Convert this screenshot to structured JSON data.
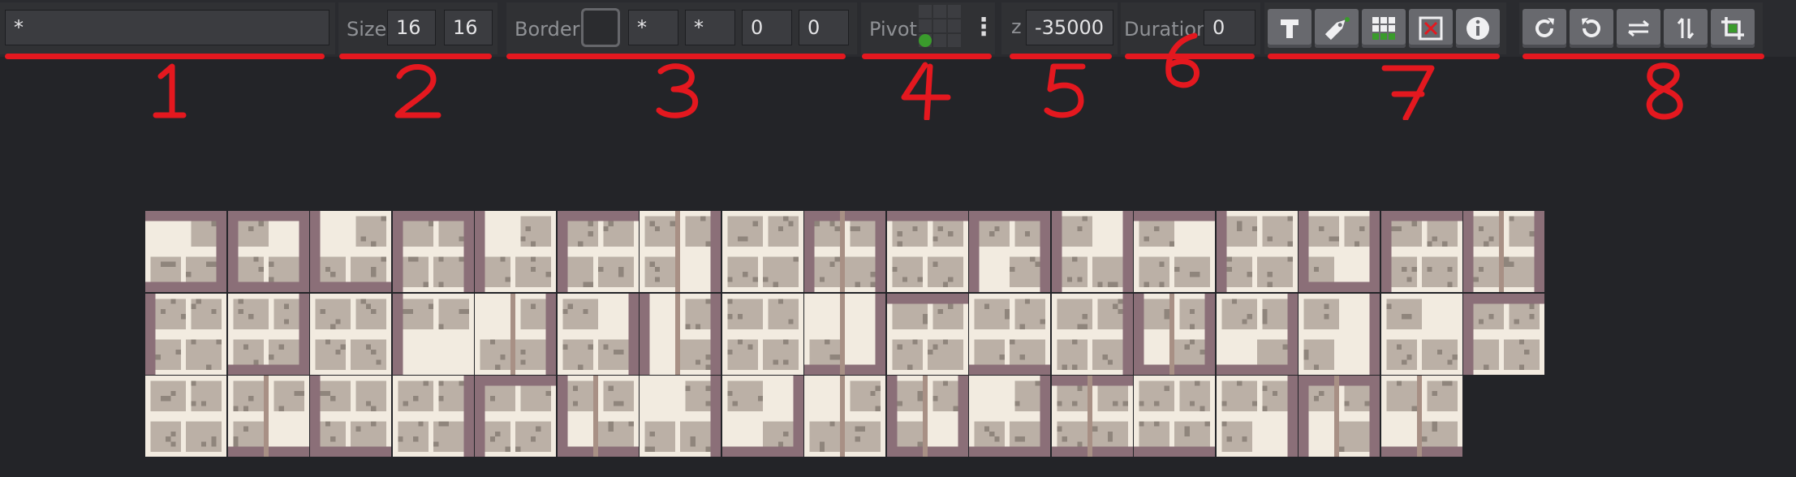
{
  "toolbar": {
    "name_field": {
      "value": "*"
    },
    "size": {
      "label": "Size",
      "width": "16",
      "height": "16"
    },
    "border": {
      "label": "Border",
      "left": "*",
      "top": "*",
      "right": "0",
      "bottom": "0"
    },
    "pivot": {
      "label": "Pivot",
      "menu_glyph": "⋮",
      "selected_cell": "bottom-left"
    },
    "z": {
      "label": "z",
      "value": "-35000"
    },
    "duration": {
      "label": "Duration",
      "value": "0"
    },
    "group7_icons": [
      "text-icon",
      "tag-icon",
      "grid-icon",
      "delete-icon",
      "info-icon"
    ],
    "group8_icons": [
      "rotate-cw-icon",
      "rotate-ccw-icon",
      "flip-horizontal-icon",
      "flip-vertical-icon",
      "crop-icon"
    ]
  },
  "annotations": [
    "1",
    "2",
    "3",
    "4",
    "5",
    "6",
    "7",
    "8"
  ],
  "sprite_grid": {
    "columns": 17,
    "rows": [
      17,
      17,
      16
    ]
  },
  "colors": {
    "annotation_red": "#e4181f",
    "pivot_selected": "#3a9b2c",
    "tile_cream": "#f2ebe0",
    "tile_stone": "#bbb0a6",
    "tile_mauve": "#8b6f78"
  }
}
